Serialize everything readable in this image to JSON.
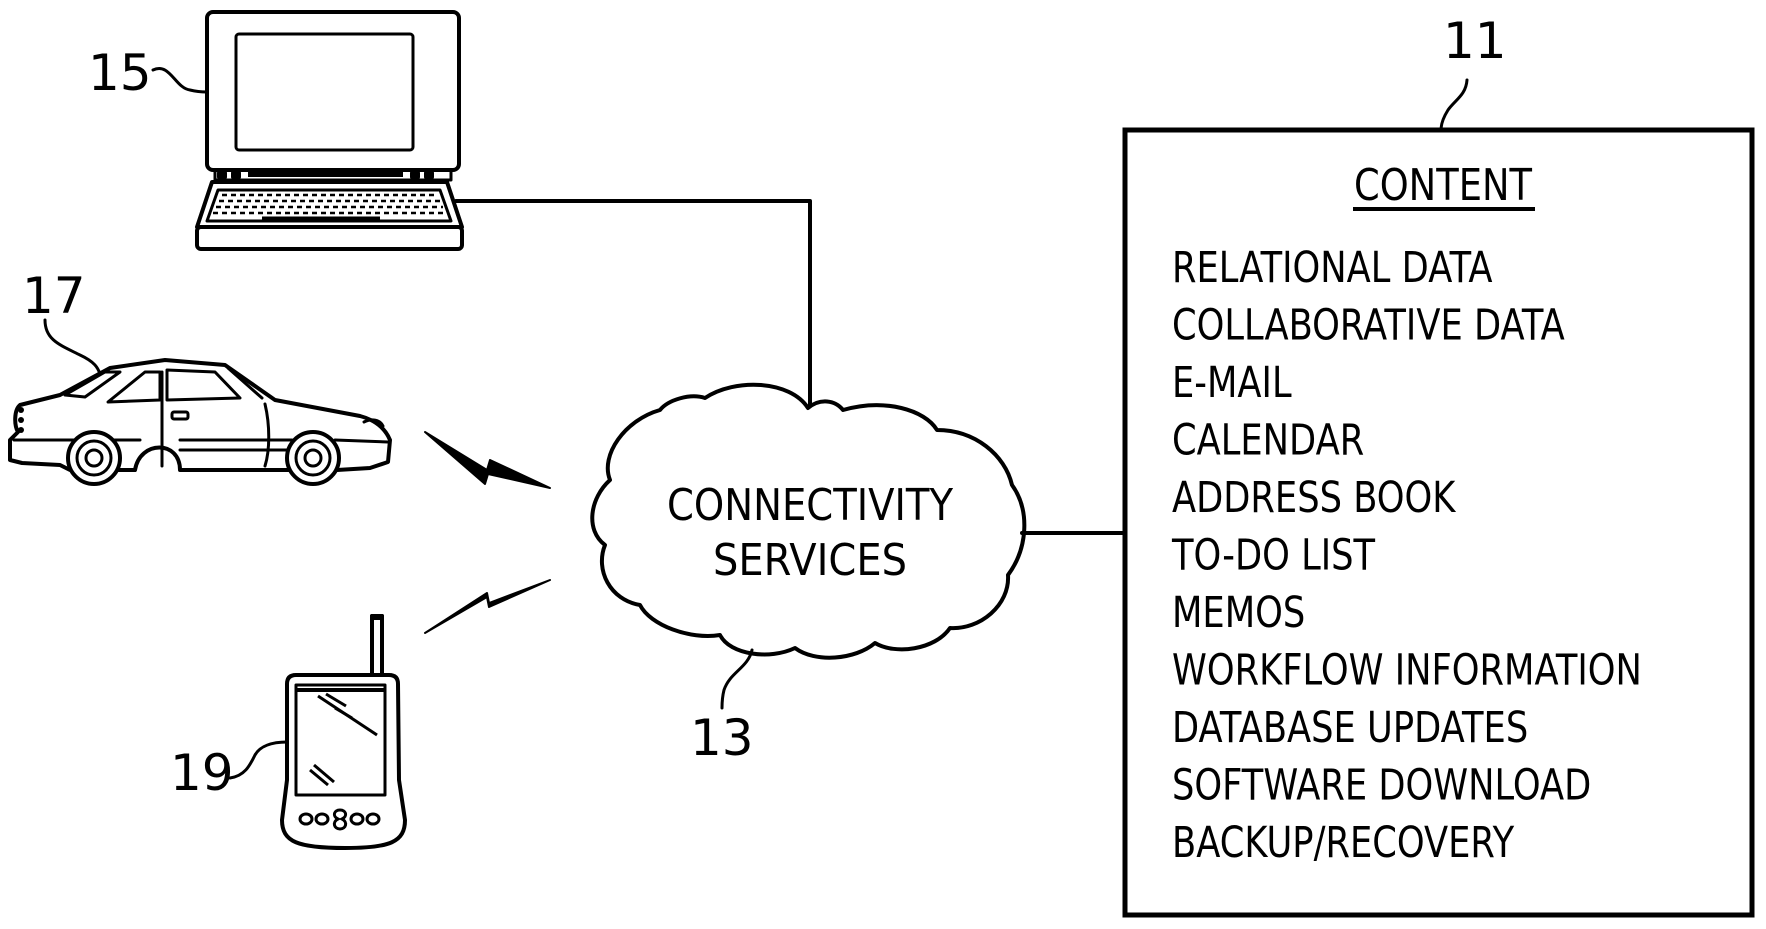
{
  "figure": {
    "reference_numerals": {
      "content_box": "11",
      "connectivity_cloud": "13",
      "laptop": "15",
      "car": "17",
      "handheld": "19"
    },
    "cloud": {
      "line1": "CONNECTIVITY",
      "line2": "SERVICES"
    },
    "content_box": {
      "title": "CONTENT",
      "items": [
        "RELATIONAL DATA",
        "COLLABORATIVE DATA",
        "E-MAIL",
        "CALENDAR",
        "ADDRESS BOOK",
        "TO-DO LIST",
        "MEMOS",
        "WORKFLOW INFORMATION",
        "DATABASE UPDATES",
        "SOFTWARE DOWNLOAD",
        "BACKUP/RECOVERY"
      ]
    },
    "devices": [
      {
        "id": "laptop",
        "icon": "laptop-icon",
        "connection": "wired"
      },
      {
        "id": "car",
        "icon": "car-icon",
        "connection": "wireless"
      },
      {
        "id": "handheld",
        "icon": "pda-icon",
        "connection": "wireless"
      }
    ]
  }
}
